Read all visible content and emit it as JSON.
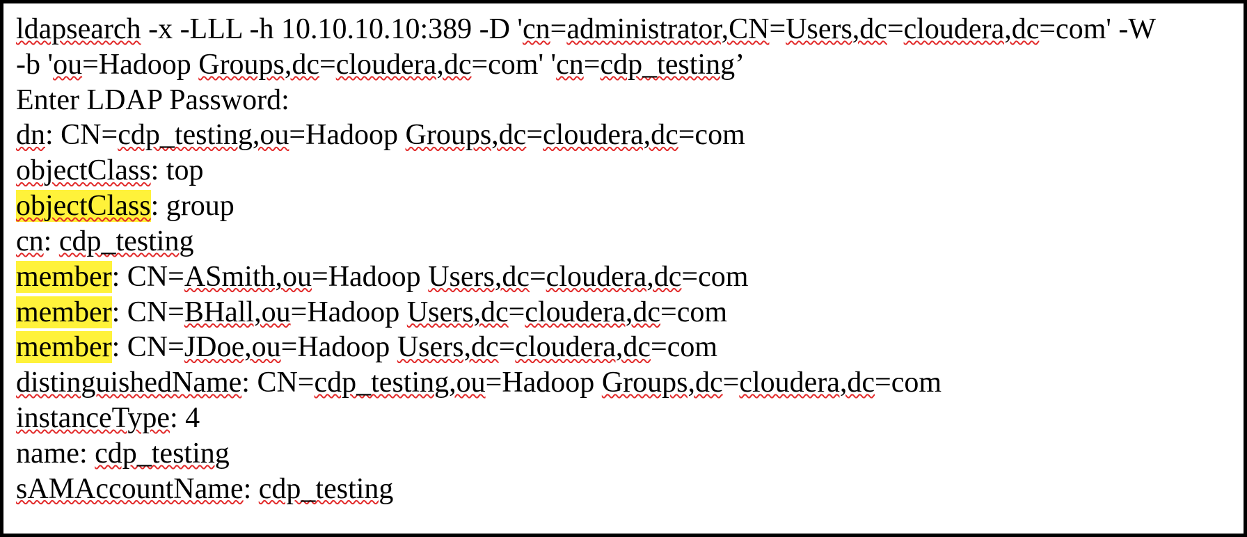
{
  "lines": {
    "l1": {
      "a": "ldapsearch",
      "b": " -x -LLL -h 10.10.10.10:389 -D '",
      "c": "cn",
      "d": "=",
      "e": "administrator,CN",
      "f": "=",
      "g": "Users,dc",
      "h": "=",
      "i": "cloudera,dc",
      "j": "=com' -W"
    },
    "l2": {
      "a": "-b '",
      "b": "ou",
      "c": "=Hadoop ",
      "d": "Groups,dc",
      "e": "=",
      "f": "cloudera,dc",
      "g": "=com' '",
      "h": "cn",
      "i": "=",
      "j": "cdp_testing",
      "k": "’"
    },
    "l3": {
      "a": "Enter LDAP Password:"
    },
    "l4": {
      "a": "dn",
      "b": ": CN=",
      "c": "cdp_testing,ou",
      "d": "=Hadoop ",
      "e": "Groups,dc",
      "f": "=",
      "g": "cloudera,dc",
      "h": "=com"
    },
    "l5": {
      "a": "objectClass",
      "b": ": top"
    },
    "l6": {
      "a": "objectClass",
      "b": ": group"
    },
    "l7": {
      "a": "cn",
      "b": ": ",
      "c": "cdp_testing"
    },
    "l8": {
      "a": "member",
      "b": ": CN=",
      "c": "ASmith,ou",
      "d": "=Hadoop ",
      "e": "Users,dc",
      "f": "=",
      "g": "cloudera,dc",
      "h": "=com"
    },
    "l9": {
      "a": "member",
      "b": ": CN=",
      "c": "BHall,ou",
      "d": "=Hadoop ",
      "e": "Users,dc",
      "f": "=",
      "g": "cloudera,dc",
      "h": "=com"
    },
    "l10": {
      "a": "member",
      "b": ": CN=",
      "c": "JDoe,ou",
      "d": "=Hadoop ",
      "e": "Users,dc",
      "f": "=",
      "g": "cloudera,dc",
      "h": "=com"
    },
    "l11": {
      "a": "distinguishedName",
      "b": ": CN=",
      "c": "cdp_testing,ou",
      "d": "=Hadoop ",
      "e": "Groups,dc",
      "f": "=",
      "g": "cloudera,dc",
      "h": "=com"
    },
    "l12": {
      "a": "instanceType",
      "b": ": 4"
    },
    "l13": {
      "a": "name: ",
      "b": "cdp_testing"
    },
    "l14": {
      "a": "sAMAccountName",
      "b": ": ",
      "c": "cdp_testing"
    }
  }
}
